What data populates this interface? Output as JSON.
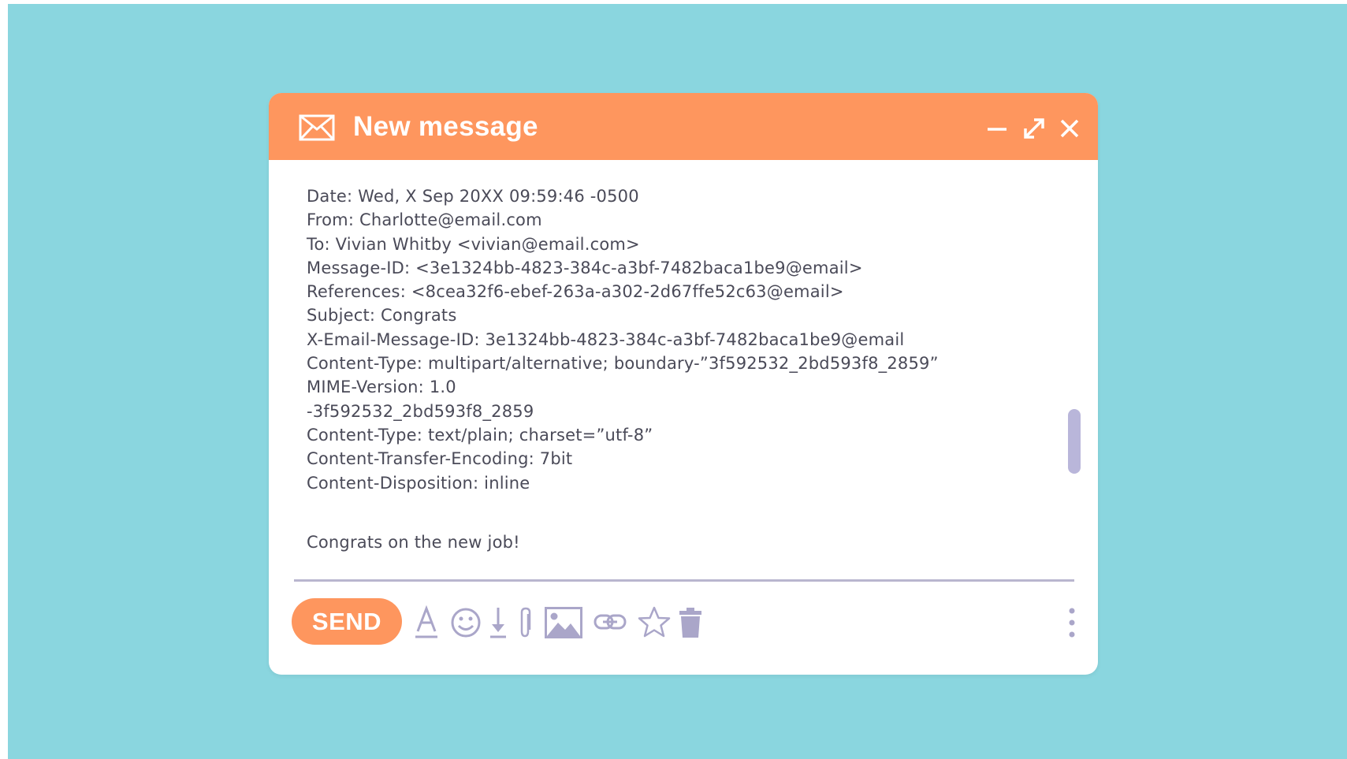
{
  "window": {
    "title": "New message",
    "icon": "mail-icon"
  },
  "controls": {
    "minimize": "minimize-icon",
    "maximize": "maximize-icon",
    "close": "close-icon"
  },
  "message": {
    "headers": [
      "Date: Wed, X Sep 20XX 09:59:46 -0500",
      "From: Charlotte@email.com",
      "To: Vivian Whitby <vivian@email.com>",
      "Message-ID: <3e1324bb-4823-384c-a3bf-7482baca1be9@email>",
      "References: <8cea32f6-ebef-263a-a302-2d67ffe52c63@email>",
      "Subject: Congrats",
      "X-Email-Message-ID: 3e1324bb-4823-384c-a3bf-7482baca1be9@email",
      "Content-Type: multipart/alternative; boundary-”3f592532_2bd593f8_2859”",
      "MIME-Version: 1.0",
      "-3f592532_2bd593f8_2859",
      "Content-Type: text/plain; charset=”utf-8”",
      "Content-Transfer-Encoding: 7bit",
      "Content-Disposition: inline"
    ],
    "body": "Congrats on the new job!"
  },
  "toolbar": {
    "send_label": "SEND",
    "tools": [
      "text-format-icon",
      "emoji-icon",
      "download-icon",
      "attachment-icon",
      "image-icon",
      "link-icon",
      "star-icon",
      "trash-icon",
      "more-options-icon"
    ]
  },
  "colors": {
    "accent": "#fe965e",
    "background": "#8ad6df",
    "icon": "#aaa6c9",
    "text": "#4a4a58"
  }
}
